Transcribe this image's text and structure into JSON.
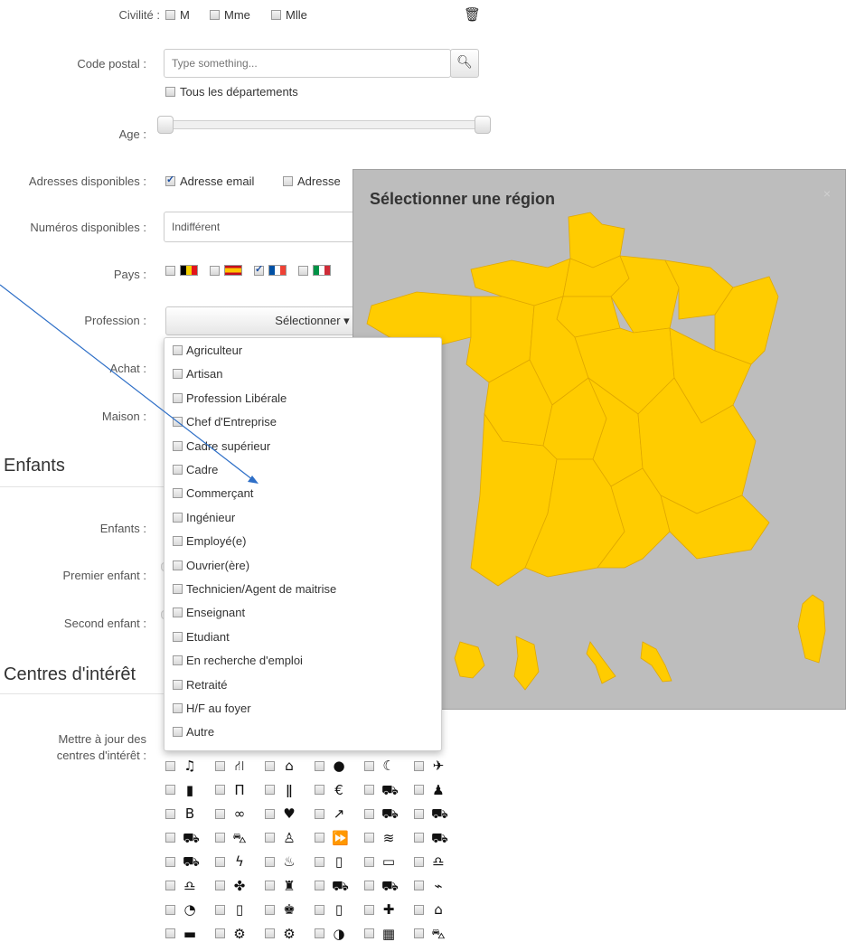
{
  "form": {
    "civilite": {
      "label": "Civilité :",
      "options": [
        "M",
        "Mme",
        "Mlle"
      ]
    },
    "code_postal": {
      "label": "Code postal :",
      "placeholder": "Type something...",
      "all_departments": "Tous les départements"
    },
    "age": {
      "label": "Age :"
    },
    "adresses": {
      "label": "Adresses disponibles :",
      "options": [
        {
          "text": "Adresse email",
          "checked": true
        },
        {
          "text": "Adresse",
          "checked": false
        }
      ]
    },
    "numeros": {
      "label": "Numéros disponibles :",
      "value": "Indifférent"
    },
    "pays": {
      "label": "Pays :",
      "flags": [
        {
          "name": "belgium-flag",
          "checked": false,
          "colors": [
            "#000000",
            "#f5d000",
            "#e3141b"
          ]
        },
        {
          "name": "spain-flag",
          "checked": false,
          "colors": [
            "#c60b1e",
            "#ffc400",
            "#c60b1e"
          ]
        },
        {
          "name": "france-flag",
          "checked": true,
          "colors": [
            "#0050a4",
            "#ffffff",
            "#ef4135"
          ]
        },
        {
          "name": "italy-flag",
          "checked": false,
          "colors": [
            "#009246",
            "#ffffff",
            "#ce2b37"
          ]
        }
      ]
    },
    "profession": {
      "label": "Profession :",
      "button": "Sélectionner ▾"
    },
    "achat": {
      "label": "Achat :"
    },
    "maison": {
      "label": "Maison :"
    }
  },
  "sections": {
    "enfants": "Enfants",
    "centres": "Centres d'intérêt"
  },
  "enfants": {
    "enfants_label": "Enfants :",
    "premier_label": "Premier enfant :",
    "second_label": "Second enfant :"
  },
  "interets": {
    "label_line1": "Mettre à jour des",
    "label_line2": "centres d'intérêt :"
  },
  "profession_options": [
    "Agriculteur",
    "Artisan",
    "Profession Libérale",
    "Chef d'Entreprise",
    "Cadre supérieur",
    "Cadre",
    "Commerçant",
    "Ingénieur",
    "Employé(e)",
    "Ouvrier(ère)",
    "Technicien/Agent de maitrise",
    "Enseignant",
    "Etudiant",
    "En recherche d'emploi",
    "Retraité",
    "H/F au foyer",
    "Autre"
  ],
  "modal": {
    "title": "Sélectionner une région",
    "close": "×",
    "map_color": "#ffcc00"
  },
  "icons": [
    [
      "music-icon",
      "road-icon",
      "bank-icon",
      "moon-phase-icon",
      "moon-icon",
      "plane-icon"
    ],
    [
      "book-icon",
      "pants-icon",
      "cutlery-icon",
      "euro-icon",
      "car-icon",
      "user-icon"
    ],
    [
      "blogger-icon",
      "binoculars-icon",
      "heart-icon",
      "arrow-icon",
      "car-icon",
      "car-icon"
    ],
    [
      "car-icon",
      "bus-icon",
      "users-icon",
      "forward-icon",
      "wifi-icon",
      "car-icon"
    ],
    [
      "car-icon",
      "bolt-icon",
      "cake-icon",
      "trash-icon",
      "tv-icon",
      "headphones-icon"
    ],
    [
      "headphones-icon",
      "gift-icon",
      "shirt-icon",
      "car-icon",
      "car-icon",
      "router-icon"
    ],
    [
      "dashboard-icon",
      "trash-icon",
      "group-icon",
      "trash-icon",
      "add-user-icon",
      "home-icon"
    ],
    [
      "monitor-icon",
      "gears-icon",
      "gears-icon",
      "contrast-icon",
      "calculator-icon",
      "bus-icon"
    ]
  ],
  "icon_glyphs": {
    "music-icon": "♫",
    "road-icon": "⛙",
    "bank-icon": "⌂",
    "moon-phase-icon": "●",
    "moon-icon": "☾",
    "plane-icon": "✈",
    "book-icon": "▮",
    "pants-icon": "Π",
    "cutlery-icon": "ǁ",
    "euro-icon": "€",
    "car-icon": "⛟",
    "user-icon": "♟",
    "blogger-icon": "B",
    "binoculars-icon": "∞",
    "heart-icon": "♥",
    "arrow-icon": "↗",
    "bus-icon": "⛍",
    "users-icon": "♙",
    "forward-icon": "⏩",
    "wifi-icon": "≋",
    "bolt-icon": "ϟ",
    "cake-icon": "♨",
    "trash-icon": "▯",
    "tv-icon": "▭",
    "headphones-icon": "♎",
    "gift-icon": "✤",
    "shirt-icon": "♜",
    "router-icon": "⌁",
    "dashboard-icon": "◔",
    "group-icon": "♚",
    "add-user-icon": "✚",
    "home-icon": "⌂",
    "monitor-icon": "▬",
    "gears-icon": "⚙",
    "contrast-icon": "◑",
    "calculator-icon": "▦"
  }
}
